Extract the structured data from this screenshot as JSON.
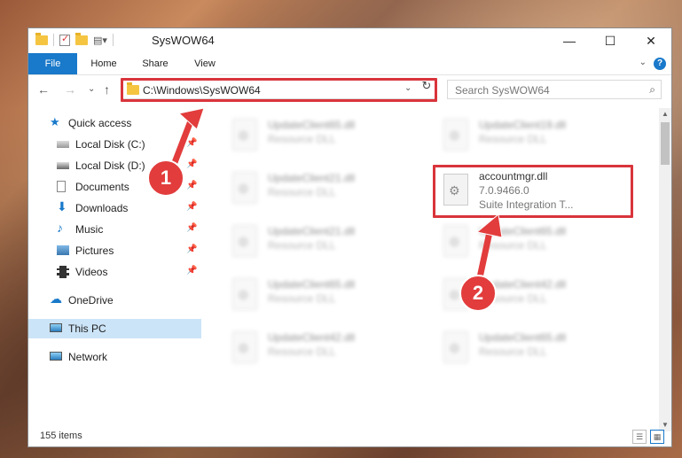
{
  "window": {
    "title": "SysWOW64"
  },
  "controls": {
    "minimize": "—",
    "maximize": "☐",
    "close": "✕"
  },
  "ribbon": {
    "tabs": [
      "File",
      "Home",
      "Share",
      "View"
    ],
    "help": "?"
  },
  "nav": {
    "back": "←",
    "forward": "→",
    "recent": "⌄",
    "up": "↑",
    "address": "C:\\Windows\\SysWOW64",
    "refresh": "↻",
    "search_placeholder": "Search SysWOW64"
  },
  "sidebar": [
    {
      "label": "Quick access",
      "icon": "star-icon",
      "pinned": false
    },
    {
      "label": "Local Disk (C:)",
      "icon": "drive-icon",
      "pinned": true
    },
    {
      "label": "Local Disk (D:)",
      "icon": "drive-icon",
      "pinned": true
    },
    {
      "label": "Documents",
      "icon": "documents-icon",
      "pinned": true
    },
    {
      "label": "Downloads",
      "icon": "download-icon",
      "pinned": true
    },
    {
      "label": "Music",
      "icon": "music-icon",
      "pinned": true
    },
    {
      "label": "Pictures",
      "icon": "pictures-icon",
      "pinned": true
    },
    {
      "label": "Videos",
      "icon": "videos-icon",
      "pinned": true
    },
    {
      "label": "OneDrive",
      "icon": "cloud-icon",
      "pinned": false
    },
    {
      "label": "This PC",
      "icon": "computer-icon",
      "pinned": false,
      "selected": true
    },
    {
      "label": "Network",
      "icon": "network-icon",
      "pinned": false
    }
  ],
  "files": {
    "left": [
      {
        "name": "UpdateClient65.dll",
        "desc": "Resource DLL"
      },
      {
        "name": "UpdateClient21.dll",
        "desc": "Resource DLL"
      },
      {
        "name": "UpdateClient21.dll",
        "desc": "Resource DLL"
      },
      {
        "name": "UpdateClient65.dll",
        "desc": "Resource DLL"
      },
      {
        "name": "UpdateClient42.dll",
        "desc": "Resource DLL"
      }
    ],
    "right": [
      {
        "name": "UpdateClient19.dll",
        "desc": "Resource DLL"
      },
      {
        "name": "accountmgr.dll",
        "version": "7.0.9466.0",
        "desc": "Suite Integration T..."
      },
      {
        "name": "UpdateClient65.dll",
        "desc": "Resource DLL"
      },
      {
        "name": "UpdateClient42.dll",
        "desc": "Resource DLL"
      },
      {
        "name": "UpdateClient65.dll",
        "desc": "Resource DLL"
      }
    ]
  },
  "status": {
    "count": "155 items"
  },
  "annotations": {
    "step1": "1",
    "step2": "2"
  },
  "colors": {
    "accent": "#1979ca",
    "highlight": "#d9343b",
    "selected": "#cce4f7"
  }
}
